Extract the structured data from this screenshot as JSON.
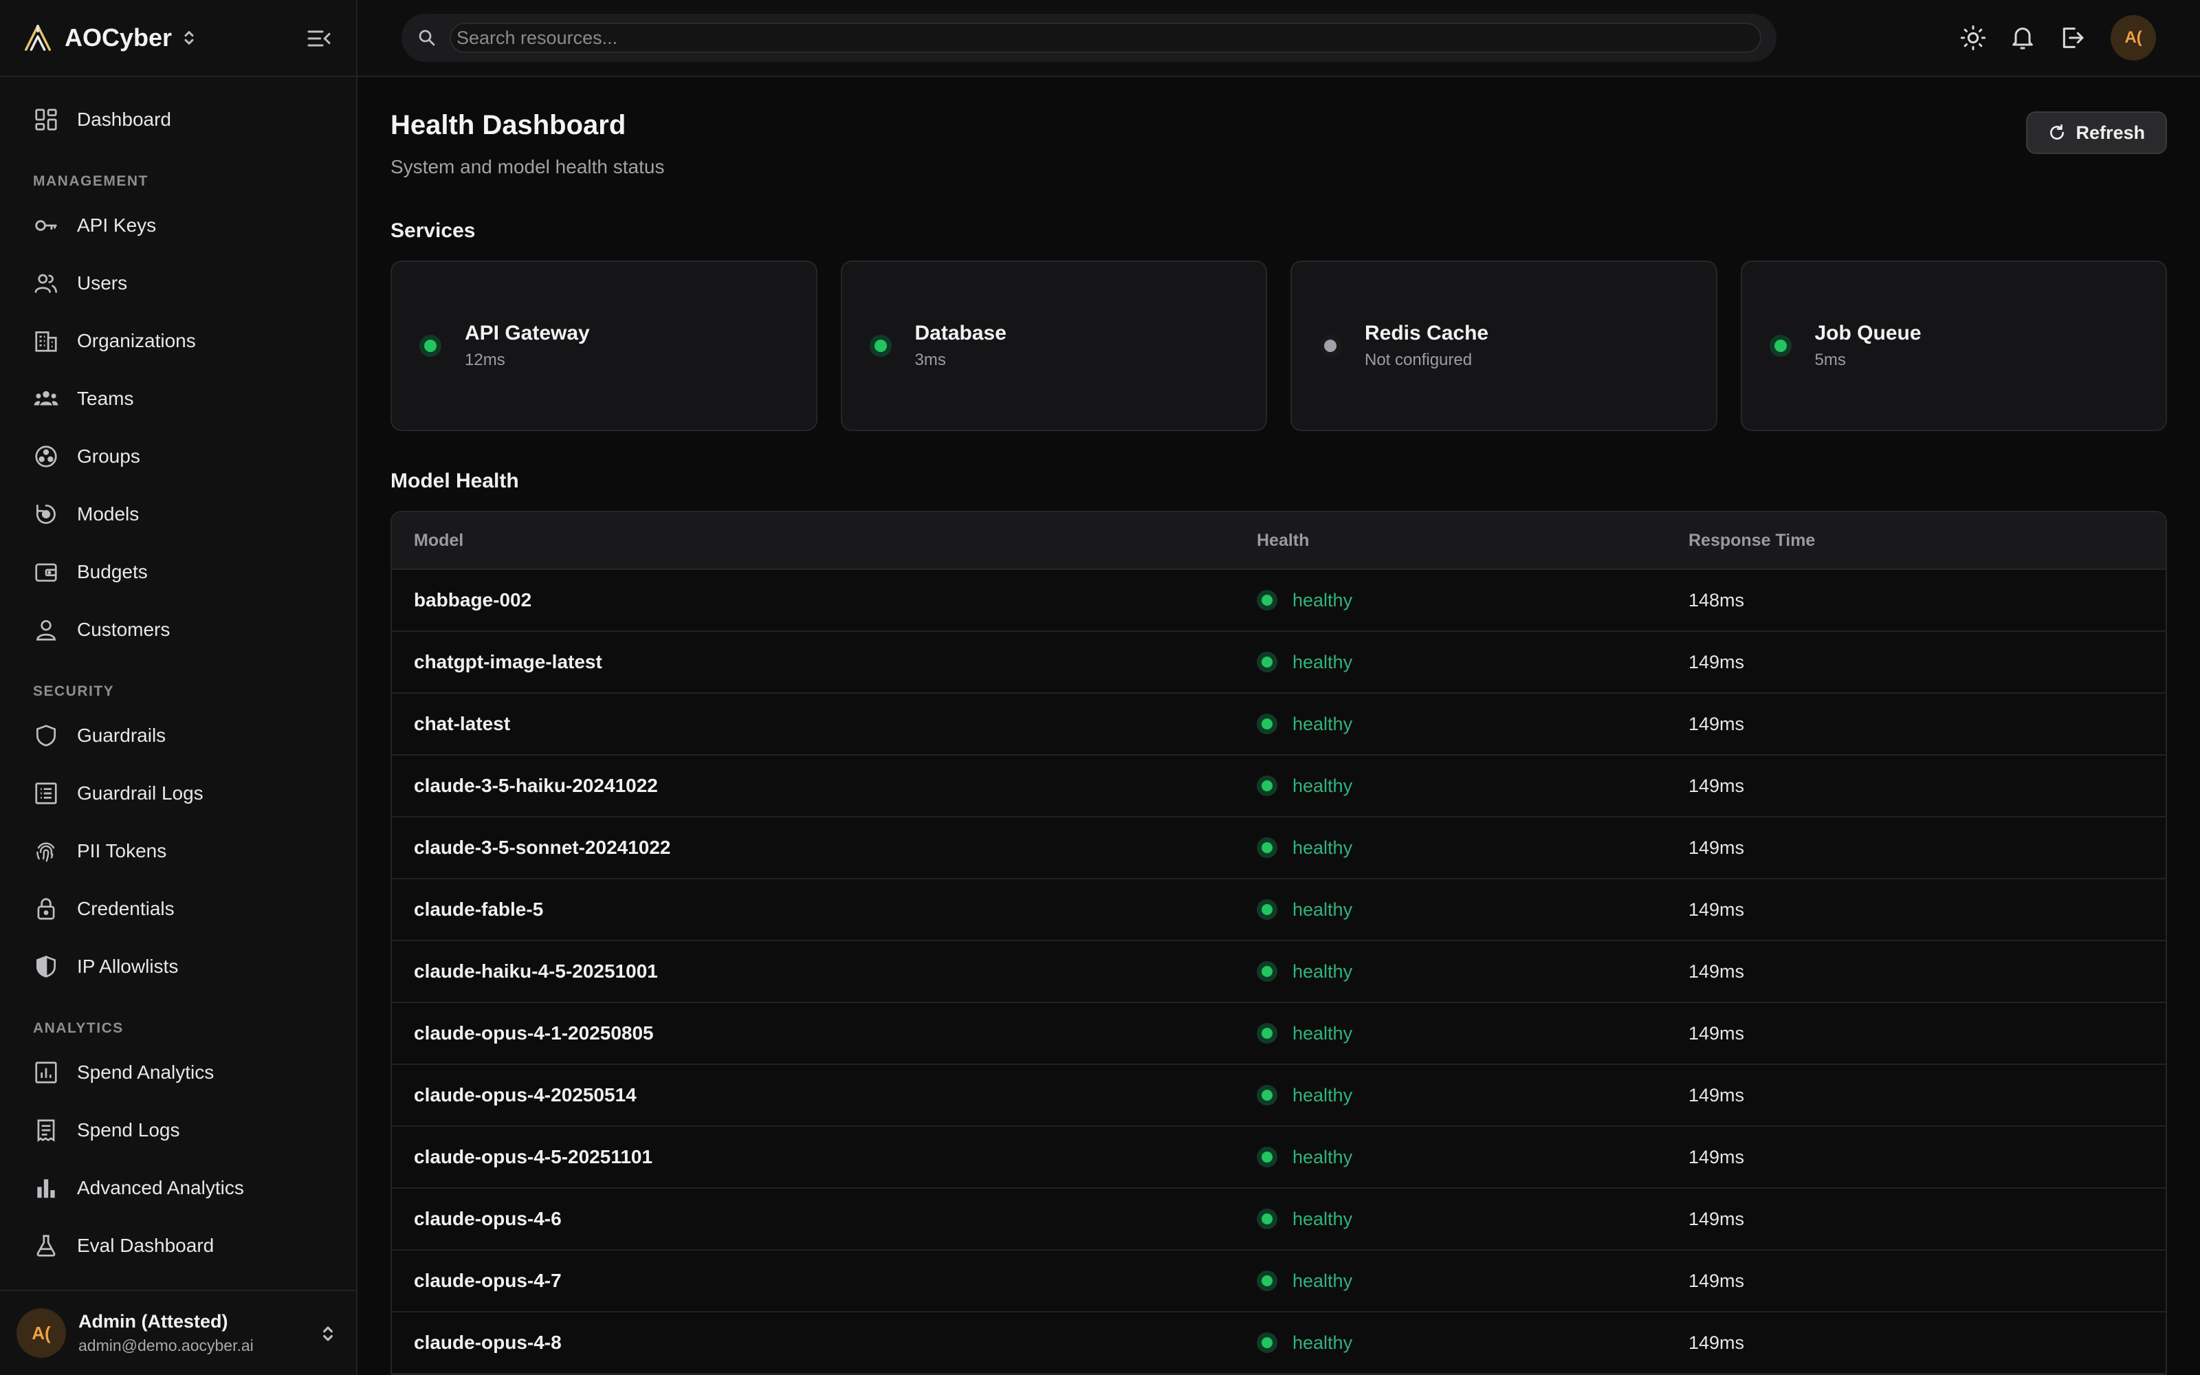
{
  "colors": {
    "healthy": "#22c55e",
    "healthy_ring": "#0f3b26",
    "unconfigured": "#a1a1aa",
    "unconfigured_ring": "#1a1a1c",
    "accent_avatar": "#f0a045"
  },
  "brand": {
    "name": "AOCyber"
  },
  "sidebar": {
    "dashboard": "Dashboard",
    "sections": [
      {
        "title": "MANAGEMENT",
        "items": [
          "API Keys",
          "Users",
          "Organizations",
          "Teams",
          "Groups",
          "Models",
          "Budgets",
          "Customers"
        ]
      },
      {
        "title": "SECURITY",
        "items": [
          "Guardrails",
          "Guardrail Logs",
          "PII Tokens",
          "Credentials",
          "IP Allowlists"
        ]
      },
      {
        "title": "ANALYTICS",
        "items": [
          "Spend Analytics",
          "Spend Logs",
          "Advanced Analytics",
          "Eval Dashboard"
        ]
      }
    ],
    "user": {
      "initials": "A(",
      "name": "Admin (Attested)",
      "email": "admin@demo.aocyber.ai"
    }
  },
  "topbar": {
    "search_placeholder": "Search resources...",
    "avatar_initials": "A("
  },
  "page": {
    "title": "Health Dashboard",
    "subtitle": "System and model health status",
    "refresh_label": "Refresh"
  },
  "services": {
    "heading": "Services",
    "items": [
      {
        "name": "API Gateway",
        "meta": "12ms",
        "status": "healthy"
      },
      {
        "name": "Database",
        "meta": "3ms",
        "status": "healthy"
      },
      {
        "name": "Redis Cache",
        "meta": "Not configured",
        "status": "unconfigured"
      },
      {
        "name": "Job Queue",
        "meta": "5ms",
        "status": "healthy"
      }
    ]
  },
  "model_health": {
    "heading": "Model Health",
    "columns": [
      "Model",
      "Health",
      "Response Time"
    ],
    "rows": [
      {
        "model": "babbage-002",
        "health": "healthy",
        "response_time": "148ms"
      },
      {
        "model": "chatgpt-image-latest",
        "health": "healthy",
        "response_time": "149ms"
      },
      {
        "model": "chat-latest",
        "health": "healthy",
        "response_time": "149ms"
      },
      {
        "model": "claude-3-5-haiku-20241022",
        "health": "healthy",
        "response_time": "149ms"
      },
      {
        "model": "claude-3-5-sonnet-20241022",
        "health": "healthy",
        "response_time": "149ms"
      },
      {
        "model": "claude-fable-5",
        "health": "healthy",
        "response_time": "149ms"
      },
      {
        "model": "claude-haiku-4-5-20251001",
        "health": "healthy",
        "response_time": "149ms"
      },
      {
        "model": "claude-opus-4-1-20250805",
        "health": "healthy",
        "response_time": "149ms"
      },
      {
        "model": "claude-opus-4-20250514",
        "health": "healthy",
        "response_time": "149ms"
      },
      {
        "model": "claude-opus-4-5-20251101",
        "health": "healthy",
        "response_time": "149ms"
      },
      {
        "model": "claude-opus-4-6",
        "health": "healthy",
        "response_time": "149ms"
      },
      {
        "model": "claude-opus-4-7",
        "health": "healthy",
        "response_time": "149ms"
      },
      {
        "model": "claude-opus-4-8",
        "health": "healthy",
        "response_time": "149ms"
      }
    ]
  }
}
